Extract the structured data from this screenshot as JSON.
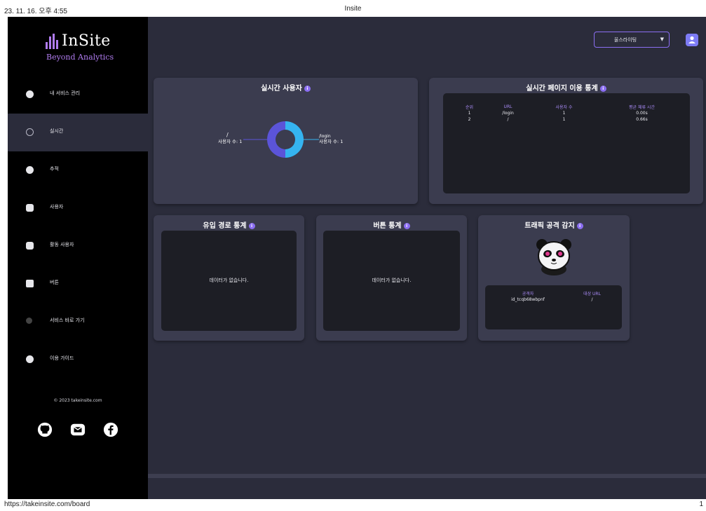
{
  "print": {
    "date": "23. 11. 16. 오후 4:55",
    "title": "Insite",
    "url": "https://takeinsite.com/board",
    "page": "1"
  },
  "brand": {
    "name": "InSite",
    "tagline": "Beyond Analytics",
    "accent": "#b07cf0"
  },
  "sidebar": {
    "items": [
      {
        "label": "내 서비스 관리",
        "icon": "gear-icon"
      },
      {
        "label": "실시간",
        "icon": "clock-icon"
      },
      {
        "label": "추적",
        "icon": "crosshair-icon"
      },
      {
        "label": "사용자",
        "icon": "user-icon"
      },
      {
        "label": "활동 사용자",
        "icon": "active-user-icon"
      },
      {
        "label": "버튼",
        "icon": "button-icon"
      },
      {
        "label": "서비스 바로 가기",
        "icon": "link-icon"
      },
      {
        "label": "이용 가이드",
        "icon": "guide-icon"
      }
    ],
    "active_index": 1,
    "copyright": "© 2023 takeinsite.com",
    "social": [
      "github-icon",
      "mail-icon",
      "facebook-icon"
    ]
  },
  "topbar": {
    "service_select": "울스라이팅",
    "select_arrow": "▼"
  },
  "realtime_users": {
    "title": "실시간 사용자",
    "info": "i",
    "left_label": "/",
    "left_count": "사용자 수: 1",
    "right_label": "/login",
    "right_count": "사용자 수: 1",
    "slice_colors": [
      "#5b54d8",
      "#35b4f0"
    ]
  },
  "page_stats": {
    "title": "실시간 페이지 이용 통계",
    "info": "i",
    "columns": [
      "순위",
      "URL",
      "사용자 수",
      "평균 체류 시간"
    ],
    "rows": [
      [
        "1",
        "/login",
        "1",
        "0.00s"
      ],
      [
        "2",
        "/",
        "1",
        "0.66s"
      ]
    ]
  },
  "inflow": {
    "title": "유입 경로 통계",
    "info": "i",
    "empty": "데이터가 없습니다."
  },
  "button_stats": {
    "title": "버튼 통계",
    "info": "i",
    "empty": "데이터가 없습니다."
  },
  "traffic": {
    "title": "트래픽 공격 감지",
    "info": "i",
    "columns": [
      "공격자",
      "대상 URL"
    ],
    "rows": [
      [
        "id_tcqb68wbpnf",
        "/"
      ]
    ]
  }
}
